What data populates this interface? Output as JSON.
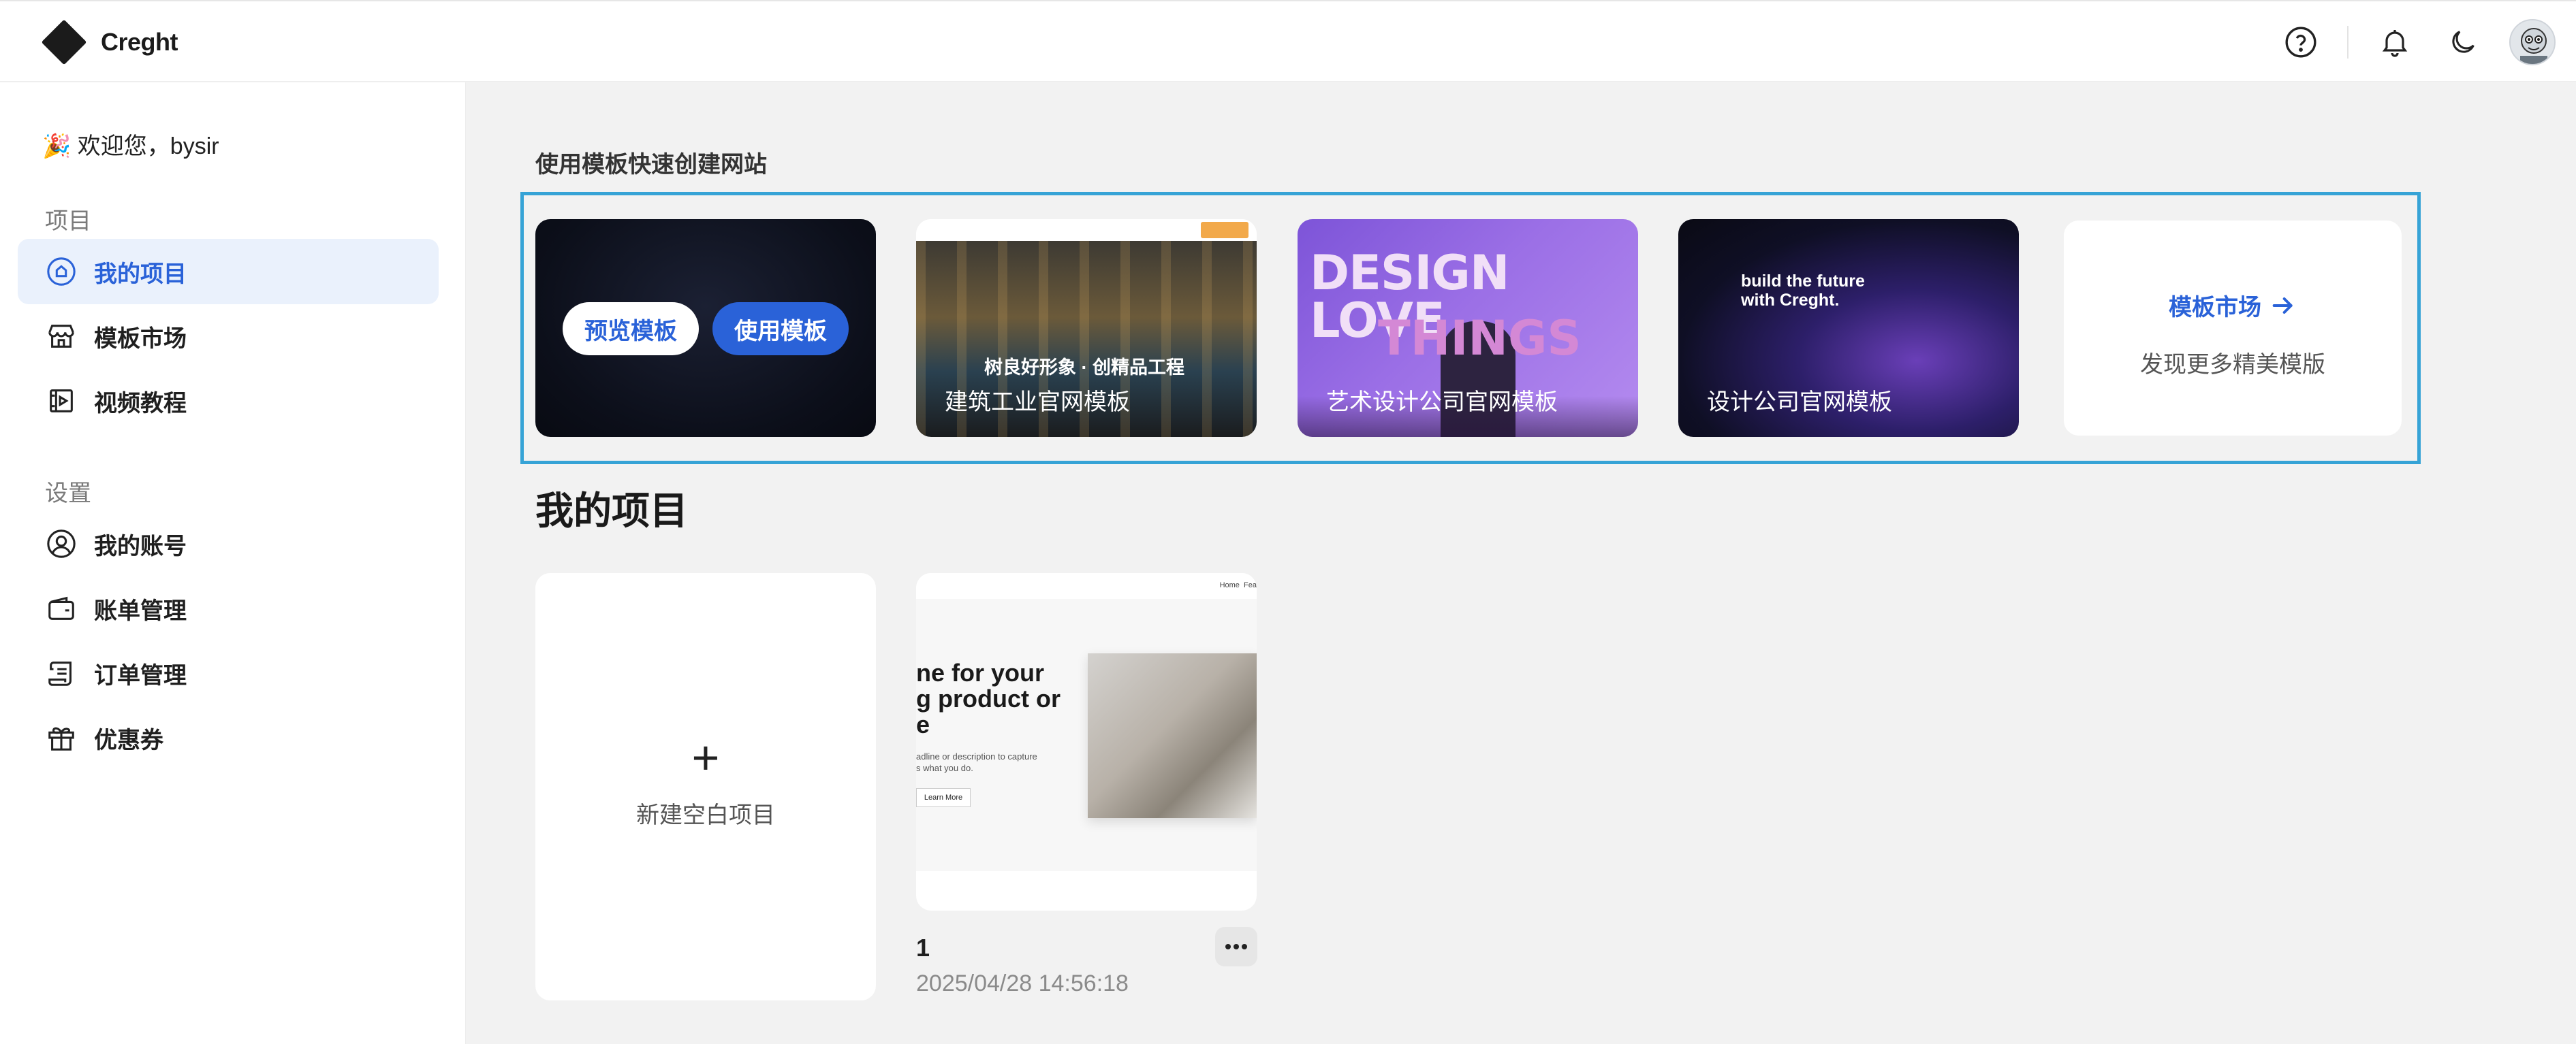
{
  "header": {
    "app_name": "Creght",
    "icons": [
      "help-icon",
      "bell-icon",
      "moon-icon"
    ]
  },
  "sidebar": {
    "welcome": "🎉 欢迎您，bysir",
    "sections": [
      {
        "title": "项目",
        "items": [
          {
            "label": "我的项目",
            "icon": "home-icon",
            "active": true
          },
          {
            "label": "模板市场",
            "icon": "store-icon",
            "active": false
          },
          {
            "label": "视频教程",
            "icon": "video-icon",
            "active": false
          }
        ]
      },
      {
        "title": "设置",
        "items": [
          {
            "label": "我的账号",
            "icon": "user-icon",
            "active": false
          },
          {
            "label": "账单管理",
            "icon": "wallet-icon",
            "active": false
          },
          {
            "label": "订单管理",
            "icon": "receipt-icon",
            "active": false
          },
          {
            "label": "优惠券",
            "icon": "gift-icon",
            "active": false
          }
        ]
      }
    ]
  },
  "templates": {
    "heading": "使用模板快速创建网站",
    "preview_label": "预览模板",
    "use_label": "使用模板",
    "cards": [
      {
        "caption": "建筑工业官网模板",
        "slogan": "树良好形象 · 创精品工程"
      },
      {
        "caption": "艺术设计公司官网模板",
        "art_line1": "DESIGN LOVE",
        "art_line2": "THINGS"
      },
      {
        "caption": "设计公司官网模板",
        "headline": "build the future\nwith Creght."
      }
    ],
    "market": {
      "label": "模板市场",
      "sub": "发现更多精美模版"
    }
  },
  "projects": {
    "title": "我的项目",
    "new_label": "新建空白项目",
    "items": [
      {
        "name": "1",
        "date": "2025/04/28 14:56:18",
        "thumb_nav": "Home  Fea",
        "thumb_headline": "ne for your\ng product or\ne",
        "thumb_desc": "adline or description to capture\ns what you do.",
        "thumb_button": "Learn More"
      }
    ]
  },
  "colors": {
    "accent": "#2a62d8",
    "highlight_border": "#36a3d6",
    "active_bg": "#eaf1fc"
  }
}
